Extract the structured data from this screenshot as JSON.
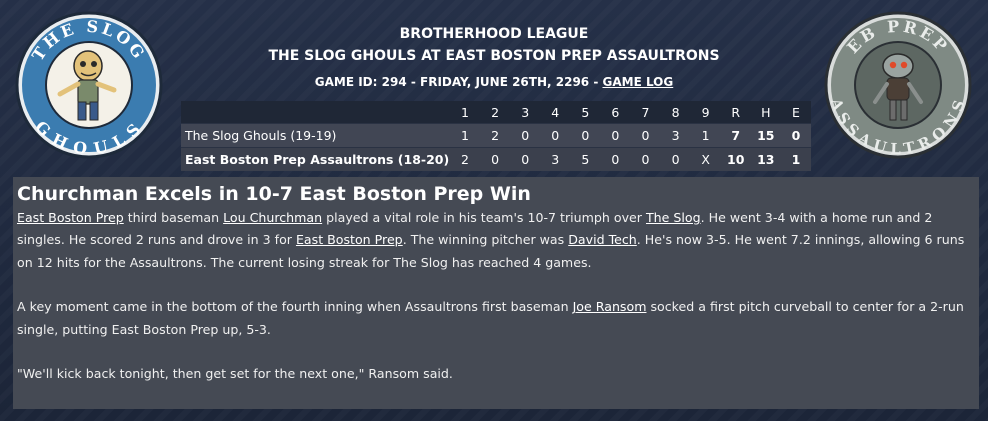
{
  "header": {
    "league": "BROTHERHOOD LEAGUE",
    "matchup": "THE SLOG GHOULS AT EAST BOSTON PREP ASSAULTRONS",
    "game_meta": "GAME ID: 294 - FRIDAY, JUNE 26TH, 2296 - ",
    "game_log_link": "GAME LOG"
  },
  "logos": {
    "away": {
      "top_text": "THE SLOG",
      "bottom_text": "GHOULS",
      "icon": "zombie-mascot-icon"
    },
    "home": {
      "top_text": "EB PREP",
      "bottom_text": "ASSAULTRONS",
      "icon": "robot-mascot-icon"
    }
  },
  "linescore": {
    "columns": [
      "1",
      "2",
      "3",
      "4",
      "5",
      "6",
      "7",
      "8",
      "9",
      "R",
      "H",
      "E"
    ],
    "rows": [
      {
        "team": "The Slog Ghouls (19-19)",
        "innings": [
          "1",
          "2",
          "0",
          "0",
          "0",
          "0",
          "0",
          "3",
          "1"
        ],
        "totals": [
          "7",
          "15",
          "0"
        ]
      },
      {
        "team": "East Boston Prep Assaultrons (18-20)",
        "innings": [
          "2",
          "0",
          "0",
          "3",
          "5",
          "0",
          "0",
          "0",
          "X"
        ],
        "totals": [
          "10",
          "13",
          "1"
        ]
      }
    ]
  },
  "story": {
    "headline": "Churchman Excels in 10-7 East Boston Prep Win",
    "p1": {
      "l1": "East Boston Prep",
      "t1": " third baseman ",
      "l2": "Lou Churchman",
      "t2": " played a vital role in his team's 10-7 triumph over ",
      "l3": "The Slog",
      "t3": ". He went 3-4 with a home run and 2 singles. He scored 2 runs and drove in 3 for ",
      "l4": "East Boston Prep",
      "t4": ". The winning pitcher was ",
      "l5": "David Tech",
      "t5": ". He's now 3-5. He went 7.2 innings, allowing 6 runs on 12 hits for the Assaultrons. The current losing streak for The Slog has reached 4 games."
    },
    "p2": {
      "t1": "A key moment came in the bottom of the fourth inning when Assaultrons first baseman ",
      "l1": "Joe Ransom",
      "t2": " socked a first pitch curveball to center for a 2-run single, putting East Boston Prep up, 5-3."
    },
    "p3": "\"We'll kick back tonight, then get set for the next one,\" Ransom said."
  }
}
